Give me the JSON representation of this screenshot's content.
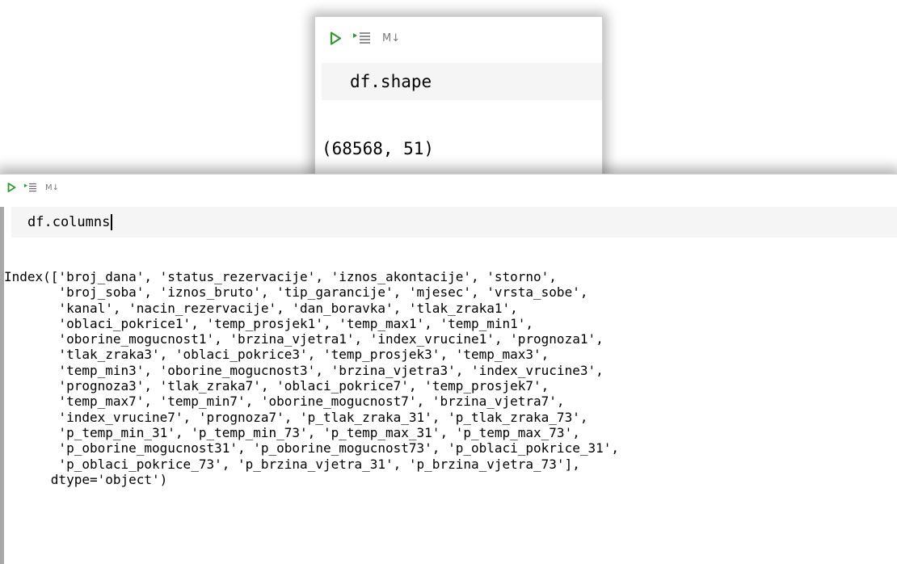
{
  "cells": [
    {
      "toolbar": {
        "md_label": "M↓"
      },
      "input": "df.shape",
      "output": "(68568, 51)"
    },
    {
      "toolbar": {
        "md_label": "M↓"
      },
      "input": "df.columns",
      "output": "Index(['broj_dana', 'status_rezervacije', 'iznos_akontacije', 'storno',\n       'broj_soba', 'iznos_bruto', 'tip_garancije', 'mjesec', 'vrsta_sobe',\n       'kanal', 'nacin_rezervacije', 'dan_boravka', 'tlak_zraka1',\n       'oblaci_pokrice1', 'temp_prosjek1', 'temp_max1', 'temp_min1',\n       'oborine_mogucnost1', 'brzina_vjetra1', 'index_vrucine1', 'prognoza1',\n       'tlak_zraka3', 'oblaci_pokrice3', 'temp_prosjek3', 'temp_max3',\n       'temp_min3', 'oborine_mogucnost3', 'brzina_vjetra3', 'index_vrucine3',\n       'prognoza3', 'tlak_zraka7', 'oblaci_pokrice7', 'temp_prosjek7',\n       'temp_max7', 'temp_min7', 'oborine_mogucnost7', 'brzina_vjetra7',\n       'index_vrucine7', 'prognoza7', 'p_tlak_zraka_31', 'p_tlak_zraka_73',\n       'p_temp_min_31', 'p_temp_min_73', 'p_temp_max_31', 'p_temp_max_73',\n       'p_oborine_mogucnost31', 'p_oborine_mogucnost73', 'p_oblaci_pokrice_31',\n       'p_oblaci_pokrice_73', 'p_brzina_vjetra_31', 'p_brzina_vjetra_73'],\n      dtype='object')"
    }
  ],
  "colors": {
    "run_icon": "#2e9a2e",
    "md_label": "#7a7a7a",
    "input_bg": "#f5f5f5"
  },
  "icons": {
    "run": "play-icon",
    "run_below": "run-below-icon"
  }
}
